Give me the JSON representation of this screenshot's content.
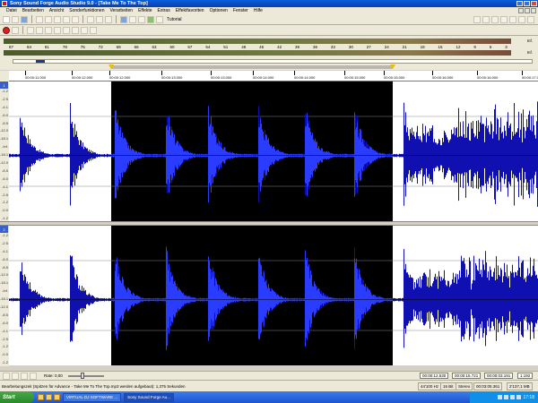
{
  "window": {
    "title": "Sony Sound Forge Audio Studio 9.0 - [Take Me To The Top]"
  },
  "menu": [
    "Datei",
    "Bearbeiten",
    "Ansicht",
    "Sonderfunktionen",
    "Verarbeiten",
    "Effekte",
    "Extras",
    "Effektfavoriten",
    "Optionen",
    "Fenster",
    "Hilfe"
  ],
  "toolbar": {
    "tutorial_label": "Tutorial"
  },
  "meter": {
    "scale": [
      "87",
      "84",
      "81",
      "78",
      "75",
      "72",
      "69",
      "66",
      "63",
      "60",
      "57",
      "54",
      "51",
      "48",
      "45",
      "42",
      "39",
      "36",
      "33",
      "30",
      "27",
      "24",
      "21",
      "18",
      "15",
      "12",
      "9",
      "6",
      "3"
    ],
    "top_label": "Inf.",
    "bottom_label": "Inf."
  },
  "ruler": {
    "ticks": [
      "00:00:11.000",
      "00:00:12.000",
      "00:00:12.000",
      "00:00:13.000",
      "00:00:13.000",
      "00:00:14.000",
      "00:00:14.000",
      "00:00:15.000",
      "00:00:15.000",
      "00:00:16.000",
      "00:00:16.000",
      "00:00:17.000"
    ]
  },
  "db_scale": [
    "-1.2",
    "-2.5",
    "-4.1",
    "-6.0",
    "-8.5",
    "-12.0",
    "-18.1",
    "-Inf.",
    "-18.1",
    "-12.0",
    "-8.5",
    "-6.0",
    "-4.1",
    "-2.5",
    "-1.2",
    "-0.0",
    "-1.2"
  ],
  "channels": [
    {
      "label": "1"
    },
    {
      "label": "2"
    }
  ],
  "transport": {
    "rate_label": "Rate: 0,00",
    "time_start": "00:00:12.530",
    "time_end": "00:00:15.721",
    "time_length": "00:00:03.191",
    "zoom": "1:192"
  },
  "status": {
    "message": "Bearbeitungszeit (Spitzen für Advance - Take Me To The Top.mp3 werden aufgebaut): 1,375 Sekunden",
    "sample_rate": "44'100 Hz",
    "bit_depth": "16 Bit",
    "channels": "Stereo",
    "duration": "00:03:05.361",
    "disk": "2'137,1 MB"
  },
  "taskbar": {
    "start_label": "Start",
    "tasks": [
      "VIRTUAL DJ SOFTWARE ...",
      "Sony Sound Forge Au..."
    ],
    "clock": "17:18"
  }
}
